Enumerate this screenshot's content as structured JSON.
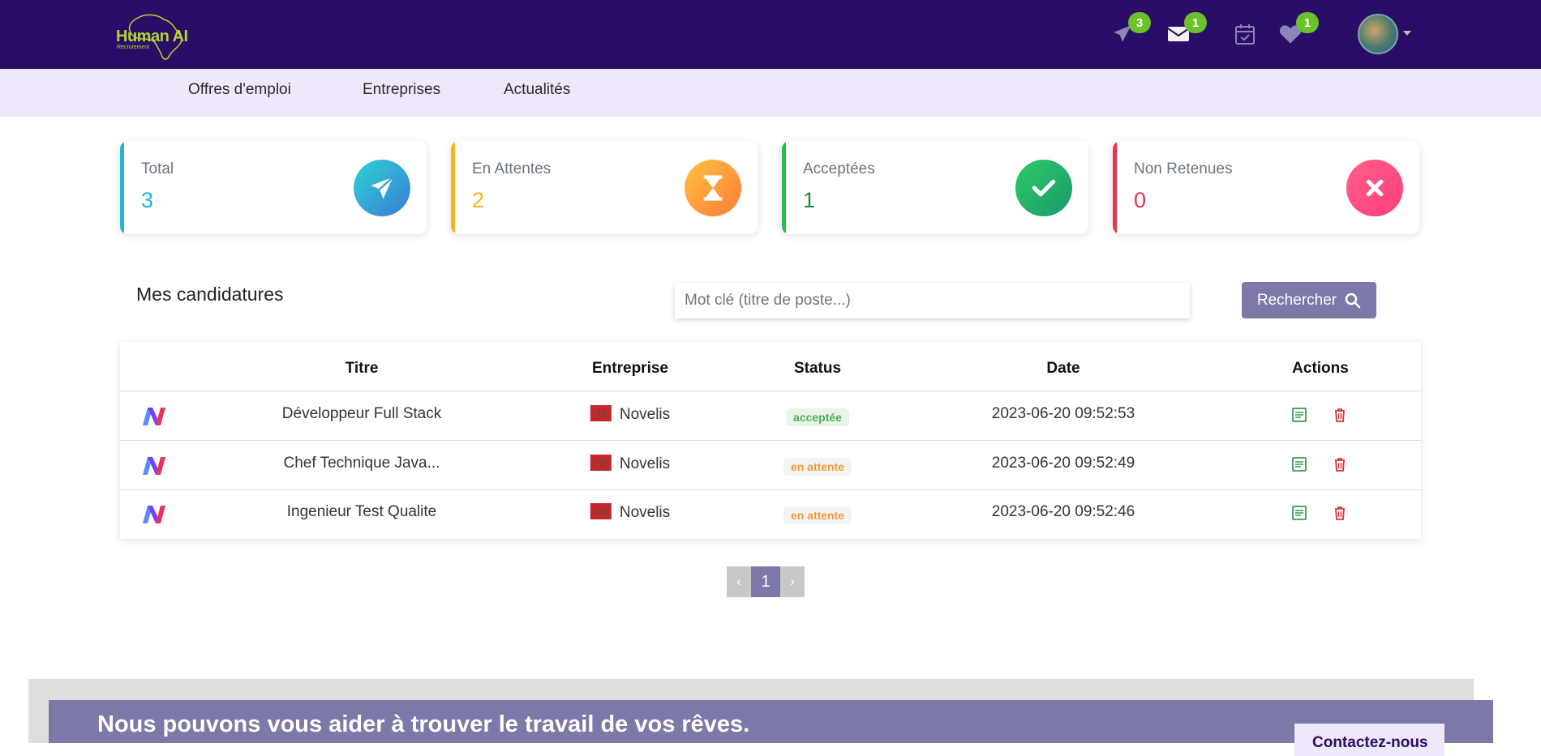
{
  "header": {
    "logo_text": "Human AI",
    "logo_subtext": "Recrutement",
    "badges": {
      "sent": "3",
      "messages": "1",
      "favorites": "1"
    }
  },
  "nav": {
    "items": [
      "Offres d'emploi",
      "Entreprises",
      "Actualités"
    ]
  },
  "stats": [
    {
      "label": "Total",
      "value": "3",
      "color": "#1fb6d6",
      "icon": "paper-plane-icon"
    },
    {
      "label": "En Attentes",
      "value": "2",
      "color": "#f6b51e",
      "icon": "hourglass-icon"
    },
    {
      "label": "Acceptées",
      "value": "1",
      "color": "#1e8a44",
      "icon": "check-icon"
    },
    {
      "label": "Non Retenues",
      "value": "0",
      "color": "#e9344b",
      "icon": "times-icon"
    }
  ],
  "applications": {
    "title": "Mes candidatures",
    "search_placeholder": "Mot clé (titre de poste...)",
    "search_button": "Rechercher",
    "columns": [
      "Titre",
      "Entreprise",
      "Status",
      "Date",
      "Actions"
    ],
    "rows": [
      {
        "title": "Développeur Full Stack",
        "company": "Novelis",
        "status": "acceptée",
        "date": "2023-06-20 09:52:53"
      },
      {
        "title": "Chef Technique Java...",
        "company": "Novelis",
        "status": "en attente",
        "date": "2023-06-20 09:52:49"
      },
      {
        "title": "Ingenieur Test Qualite",
        "company": "Novelis",
        "status": "en attente",
        "date": "2023-06-20 09:52:46"
      }
    ]
  },
  "pagination": {
    "prev": "‹",
    "current": "1",
    "next": "›"
  },
  "cta": {
    "text": "Nous pouvons vous aider à trouver le travail de vos rêves.",
    "button": "Contactez-nous"
  }
}
